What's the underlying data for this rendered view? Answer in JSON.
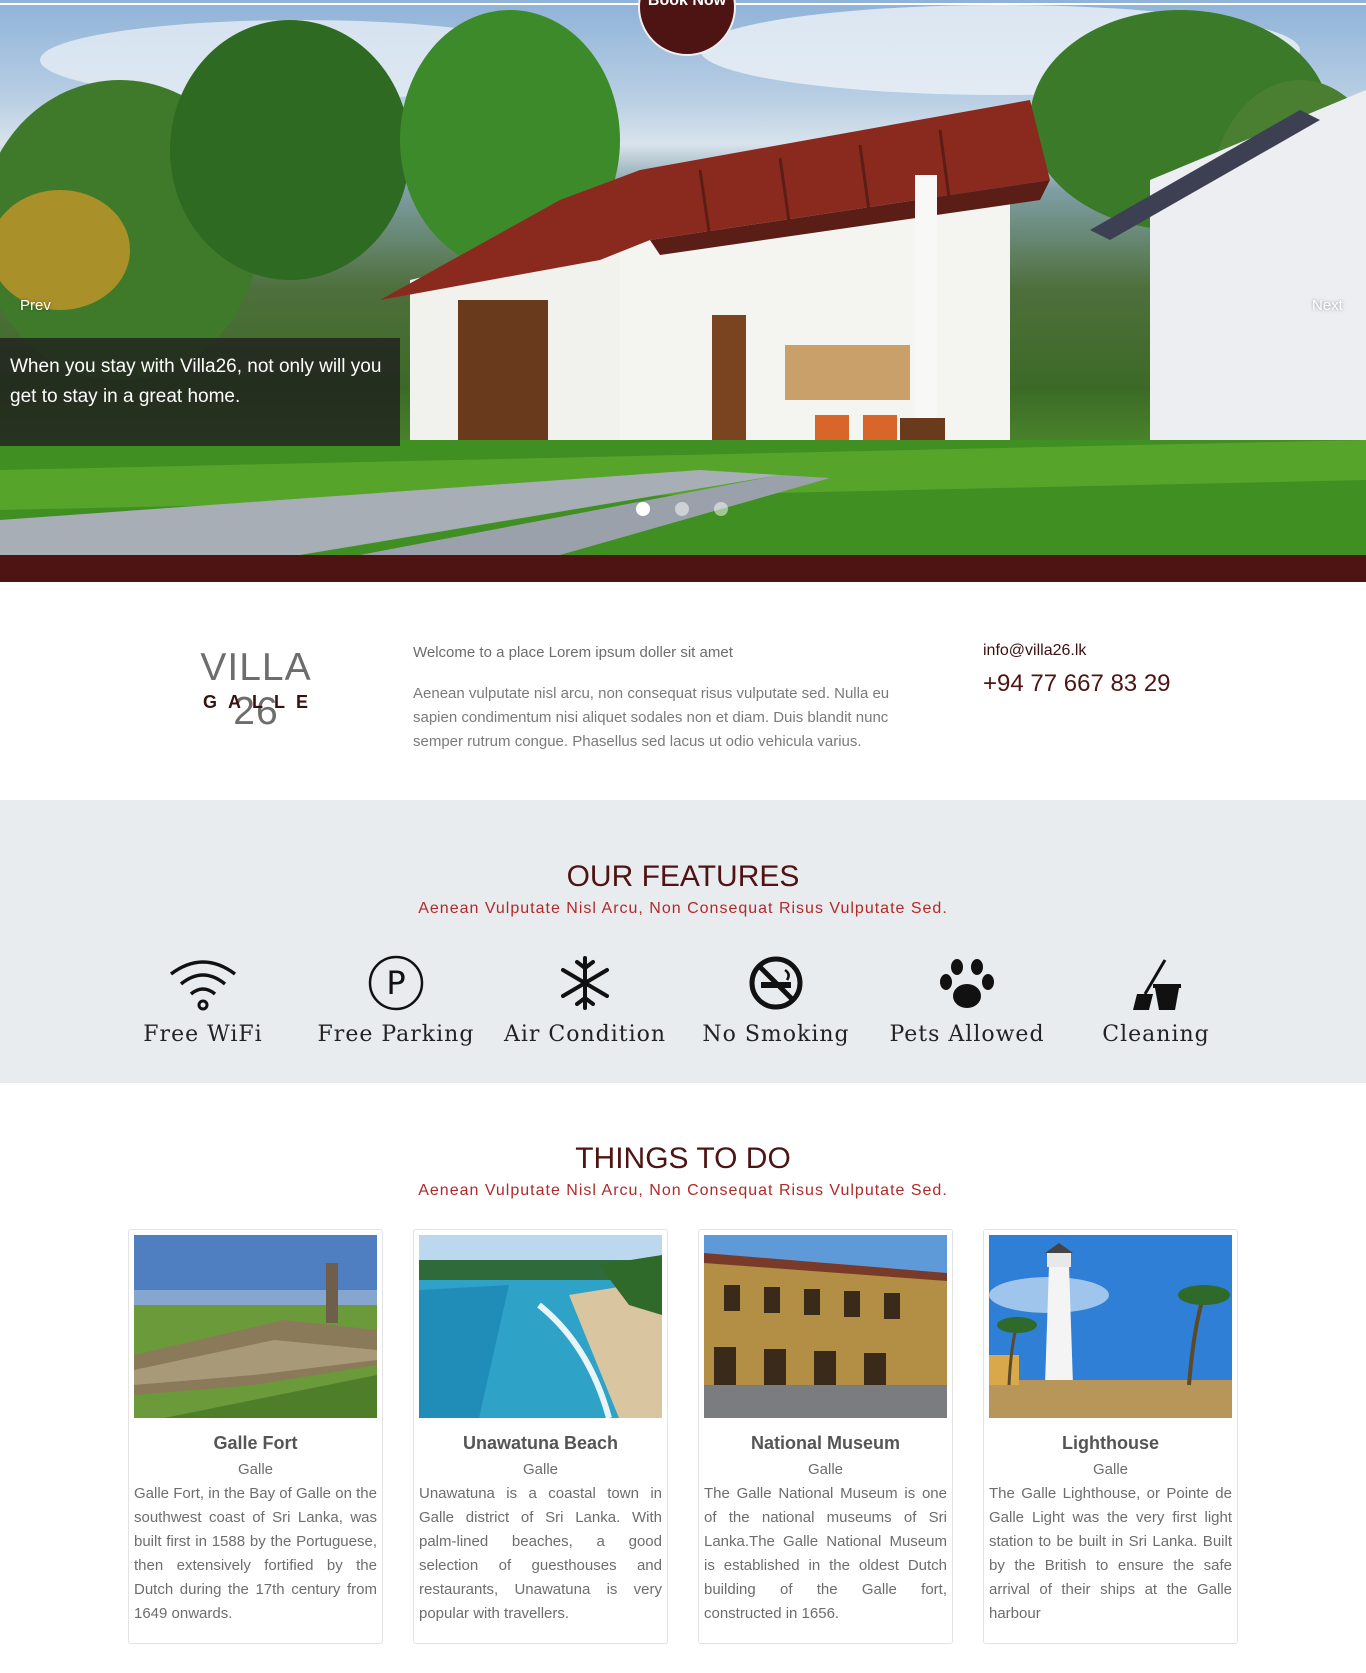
{
  "hero": {
    "book_now": "Book Now",
    "prev": "Prev",
    "next": "Next",
    "caption": "When you stay with Villa26, not only will you get to stay in a great home.",
    "slide_count": 3,
    "active_slide": 1
  },
  "intro": {
    "brand_title": "VILLA 26",
    "brand_sub": "GALLE",
    "lead": "Welcome to a place Lorem ipsum doller sit amet",
    "body": "Aenean vulputate nisl arcu, non consequat risus vulputate sed. Nulla eu sapien condimentum nisi aliquet sodales non et diam. Duis blandit nunc semper rutrum congue. Phasellus sed lacus ut odio vehicula varius.",
    "email": "info@villa26.lk",
    "phone": "+94 77 667 83 29"
  },
  "features": {
    "title": "OUR FEATURES",
    "subtitle": "Aenean Vulputate Nisl Arcu, Non Consequat Risus Vulputate Sed.",
    "items": [
      {
        "label": "Free WiFi",
        "icon": "wifi-icon"
      },
      {
        "label": "Free Parking",
        "icon": "parking-icon"
      },
      {
        "label": "Air Condition",
        "icon": "snowflake-icon"
      },
      {
        "label": "No Smoking",
        "icon": "no-smoking-icon"
      },
      {
        "label": "Pets Allowed",
        "icon": "paw-icon"
      },
      {
        "label": "Cleaning",
        "icon": "broom-bucket-icon"
      }
    ]
  },
  "things": {
    "title": "THINGS TO DO",
    "subtitle": "Aenean Vulputate Nisl Arcu, Non Consequat Risus Vulputate Sed.",
    "cards": [
      {
        "name": "Galle Fort",
        "location": "Galle",
        "description": "Galle Fort, in the Bay of Galle on the southwest coast of Sri Lanka, was built first in 1588 by the Portuguese, then extensively fortified by the Dutch during the 17th century from 1649 onwards."
      },
      {
        "name": "Unawatuna Beach",
        "location": "Galle",
        "description": "Unawatuna is a coastal town in Galle district of Sri Lanka. With palm-lined beaches, a good selection of guesthouses and restaurants, Unawatuna is very popular with travellers."
      },
      {
        "name": "National Museum",
        "location": "Galle",
        "description": "The Galle National Museum is one of the national museums of Sri Lanka.The Galle National Museum is established in the oldest Dutch building of the Galle fort, constructed in 1656."
      },
      {
        "name": "Lighthouse",
        "location": "Galle",
        "description": "The Galle Lighthouse, or Pointe de Galle Light was the very first light station to be built in Sri Lanka. Built by the British to ensure the safe arrival of their ships at the Galle harbour"
      }
    ]
  },
  "colors": {
    "brand_maroon": "#4e1414",
    "subtitle_red": "#b02a2a",
    "features_bg": "#e9ecef"
  }
}
